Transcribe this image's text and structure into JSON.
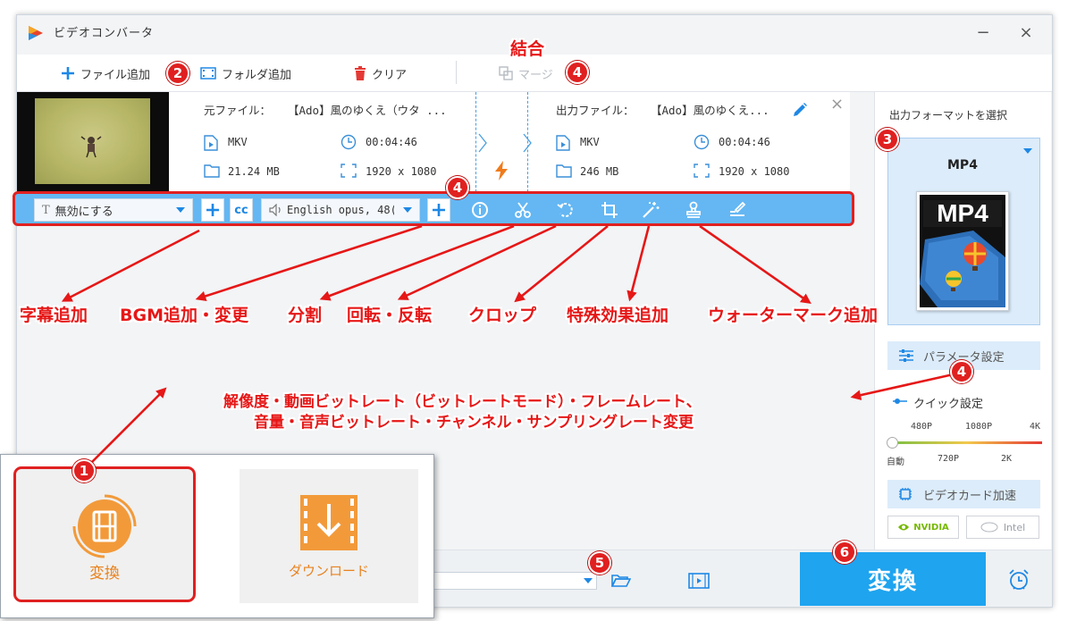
{
  "window": {
    "title": "ビデオコンバータ",
    "minimize": "−",
    "close": "×"
  },
  "toolbar": {
    "add_file": "ファイル追加",
    "add_folder": "フォルダ追加",
    "clear": "クリア",
    "merge": "マージ"
  },
  "file": {
    "source_label": "元ファイル：",
    "source_name": "【Ado】風のゆくえ（ウタ ...",
    "source_format": "MKV",
    "source_duration": "00:04:46",
    "source_size": "21.24 MB",
    "source_resolution": "1920 x 1080",
    "output_label": "出力ファイル：",
    "output_name": "【Ado】風のゆくえ...",
    "output_format": "MKV",
    "output_duration": "00:04:46",
    "output_size": "246 MB",
    "output_resolution": "1920 x 1080"
  },
  "edit_bar": {
    "subtitle_value": "無効にする",
    "audio_value": "English opus, 48("
  },
  "right_panel": {
    "select_format_label": "出力フォーマットを選択",
    "format_name": "MP4",
    "format_icon_text": "MP4",
    "params_button": "パラメータ設定",
    "quick_label": "クイック設定",
    "quality_top": [
      "480P",
      "1080P",
      "4K"
    ],
    "quality_bottom": [
      "自動",
      "720P",
      "2K"
    ],
    "gpu_label": "ビデオカード加速",
    "nvidia": "NVIDIA",
    "intel": "Intel"
  },
  "bottom": {
    "convert_button": "変換"
  },
  "inset": {
    "convert_label": "変換",
    "download_label": "ダウンロード"
  },
  "annotations": {
    "merge_title": "結合",
    "subtitle_add": "字幕追加",
    "bgm": "BGM追加・変更",
    "split": "分割",
    "rotate": "回転・反転",
    "crop": "クロップ",
    "effects": "特殊効果追加",
    "watermark": "ウォーターマーク追加",
    "params_line1": "解像度・動画ビットレート（ビットレートモード）・フレームレート、",
    "params_line2": "音量・音声ビットレート・チャンネル・サンプリングレート変更",
    "badges": [
      "1",
      "2",
      "3",
      "4",
      "4",
      "4",
      "5",
      "6"
    ]
  },
  "colors": {
    "accent": "#1fa4ef",
    "annotation": "#e61717",
    "edit_bar": "#64b7f3",
    "orange": "#f29a3a"
  }
}
